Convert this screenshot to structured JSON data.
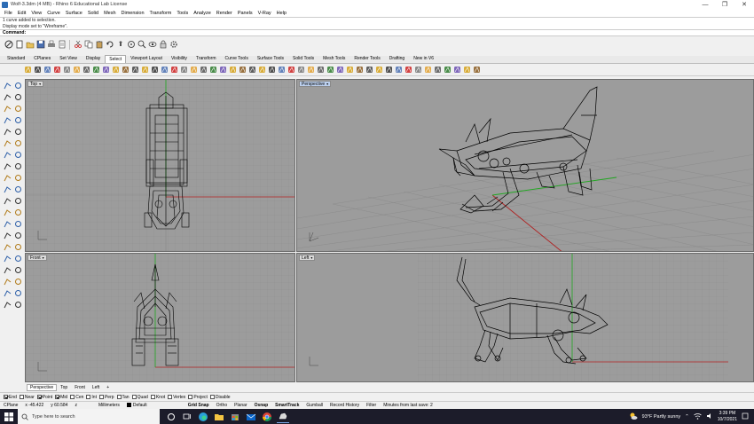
{
  "window": {
    "title": "Wolf-3.3dm (4 MB) - Rhino 6 Educational Lab License",
    "minimize": "—",
    "maximize": "❐",
    "close": "✕"
  },
  "menu": [
    "File",
    "Edit",
    "View",
    "Curve",
    "Surface",
    "Solid",
    "Mesh",
    "Dimension",
    "Transform",
    "Tools",
    "Analyze",
    "Render",
    "Panels",
    "V-Ray",
    "Help"
  ],
  "command_history": [
    "1 curve added to selection.",
    "Display mode set to \"Wireframe\"."
  ],
  "command_prompt": "Command:",
  "tabs": [
    "Standard",
    "CPlanes",
    "Set View",
    "Display",
    "Select",
    "Viewport Layout",
    "Visibility",
    "Transform",
    "Curve Tools",
    "Surface Tools",
    "Solid Tools",
    "Mesh Tools",
    "Render Tools",
    "Drafting",
    "New in V6"
  ],
  "active_tab": "Select",
  "viewports": {
    "top": "Top",
    "perspective": "Perspective",
    "front": "Front",
    "left": "Left"
  },
  "viewport_tabs": [
    "Perspective",
    "Top",
    "Front",
    "Left",
    "+"
  ],
  "active_viewport_tab": "Perspective",
  "osnaps": [
    {
      "label": "End",
      "on": true
    },
    {
      "label": "Near",
      "on": false
    },
    {
      "label": "Point",
      "on": true
    },
    {
      "label": "Mid",
      "on": true
    },
    {
      "label": "Cen",
      "on": false
    },
    {
      "label": "Int",
      "on": false
    },
    {
      "label": "Perp",
      "on": false
    },
    {
      "label": "Tan",
      "on": false
    },
    {
      "label": "Quad",
      "on": false
    },
    {
      "label": "Knot",
      "on": false
    },
    {
      "label": "Vertex",
      "on": false
    },
    {
      "label": "Project",
      "on": false
    },
    {
      "label": "Disable",
      "on": false
    }
  ],
  "status": {
    "cplane": "CPlane",
    "x": "x -45.422",
    "y": "y 60.584",
    "z": "z",
    "units": "Millimeters",
    "layer": "Default",
    "grid_snap": "Grid Snap",
    "ortho": "Ortho",
    "planar": "Planar",
    "osnap": "Osnap",
    "smarttrack": "SmartTrack",
    "gumball": "Gumball",
    "record_history": "Record History",
    "filter": "Filter",
    "save_info": "Minutes from last save: 2"
  },
  "taskbar": {
    "search_placeholder": "Type here to search",
    "weather": "93°F  Partly sunny",
    "time": "3:39 PM",
    "date": "10/7/2021"
  },
  "colors": {
    "viewport_bg": "#9c9c9c",
    "grid_line": "#8a8a8a",
    "x_axis": "#b02020",
    "y_axis": "#1fa81f",
    "taskbar": "#1c1c2a"
  }
}
